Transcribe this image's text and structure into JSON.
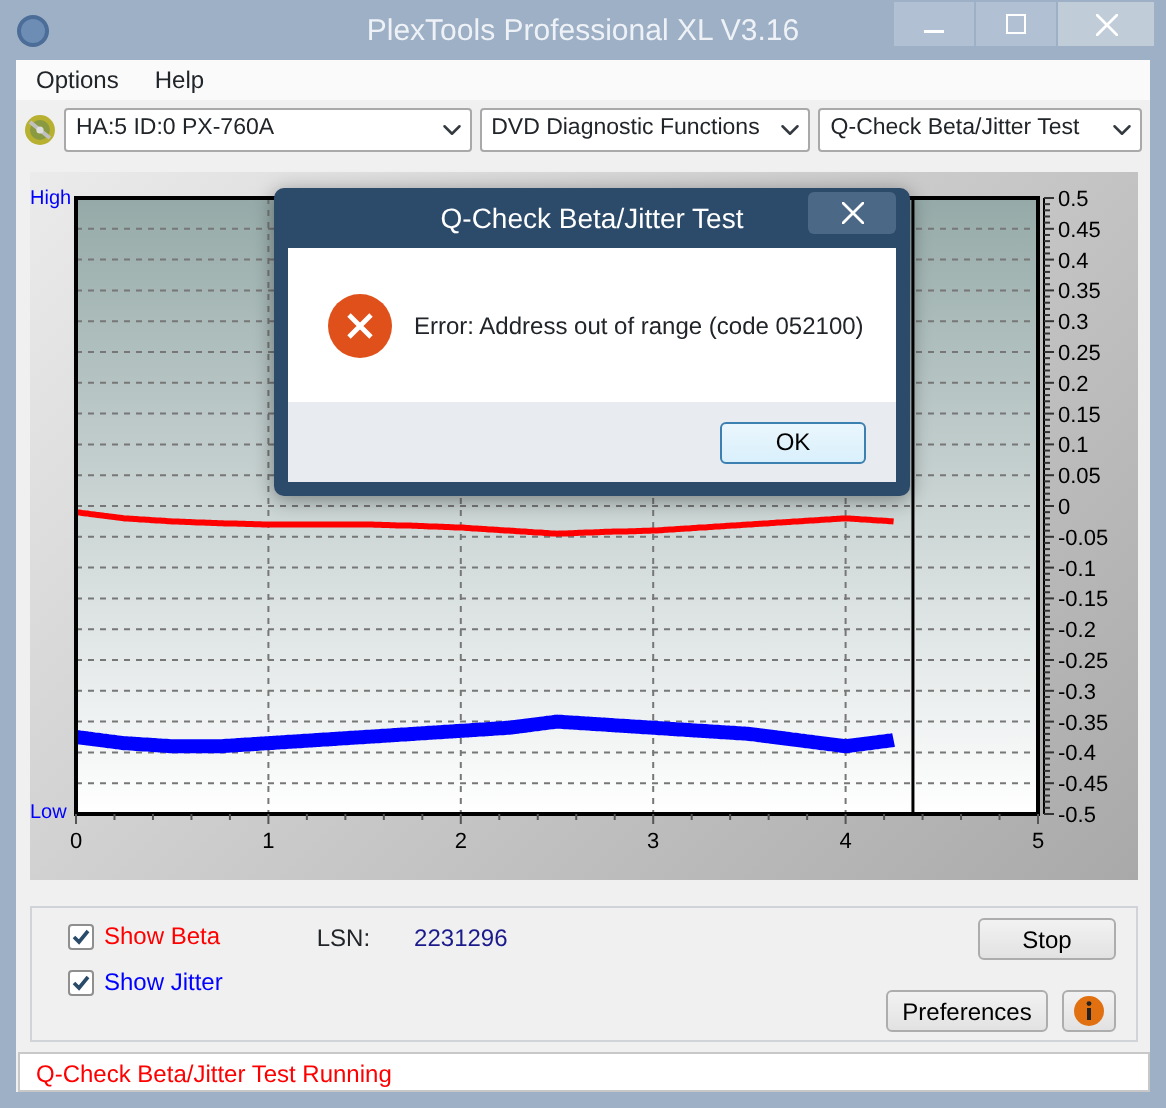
{
  "window": {
    "title": "PlexTools Professional XL V3.16"
  },
  "menu": [
    {
      "label": "Options"
    },
    {
      "label": "Help"
    }
  ],
  "toolbar": {
    "drive": "HA:5 ID:0  PX-760A",
    "category": "DVD Diagnostic Functions",
    "test": "Q-Check Beta/Jitter Test"
  },
  "chart": {
    "high_label": "High",
    "low_label": "Low",
    "chart_data": {
      "type": "line",
      "x": [
        0,
        0.25,
        0.5,
        0.75,
        1,
        1.25,
        1.5,
        1.75,
        2,
        2.25,
        2.5,
        2.75,
        3,
        3.25,
        3.5,
        3.75,
        4,
        4.25
      ],
      "series": [
        {
          "color": "#ff0000",
          "values": [
            -0.01,
            -0.02,
            -0.025,
            -0.028,
            -0.03,
            -0.03,
            -0.03,
            -0.032,
            -0.035,
            -0.04,
            -0.045,
            -0.042,
            -0.04,
            -0.035,
            -0.03,
            -0.025,
            -0.02,
            -0.025
          ]
        },
        {
          "color": "#0000ff",
          "values": [
            -0.375,
            -0.385,
            -0.39,
            -0.39,
            -0.385,
            -0.38,
            -0.375,
            -0.37,
            -0.365,
            -0.36,
            -0.35,
            -0.355,
            -0.36,
            -0.365,
            -0.37,
            -0.38,
            -0.39,
            -0.38
          ]
        }
      ],
      "xlim": [
        0,
        5
      ],
      "ylim": [
        -0.5,
        0.5
      ],
      "xticks": [
        0,
        1,
        2,
        3,
        4,
        5
      ],
      "yticks": [
        0.5,
        0.45,
        0.4,
        0.35,
        0.3,
        0.25,
        0.2,
        0.15,
        0.1,
        0.05,
        0,
        -0.05,
        -0.1,
        -0.15,
        -0.2,
        -0.25,
        -0.3,
        -0.35,
        -0.4,
        -0.45,
        -0.5
      ],
      "grid": true,
      "ref_lines": [
        {
          "axis": "x",
          "value": 4.35,
          "color": "#000000"
        }
      ]
    }
  },
  "dialog": {
    "title": "Q-Check Beta/Jitter Test",
    "message": "Error: Address out of range (code 052100)",
    "buttons": [
      "OK"
    ]
  },
  "options": [
    {
      "label": "Show Beta",
      "checked": true,
      "color": "#ff0000"
    },
    {
      "label": "Show Jitter",
      "checked": true,
      "color": "#0000ff"
    }
  ],
  "lsn": {
    "label": "LSN:",
    "value": "2231296"
  },
  "buttons": [
    "Stop",
    "Preferences"
  ],
  "status_bar": "Q-Check Beta/Jitter Test Running"
}
